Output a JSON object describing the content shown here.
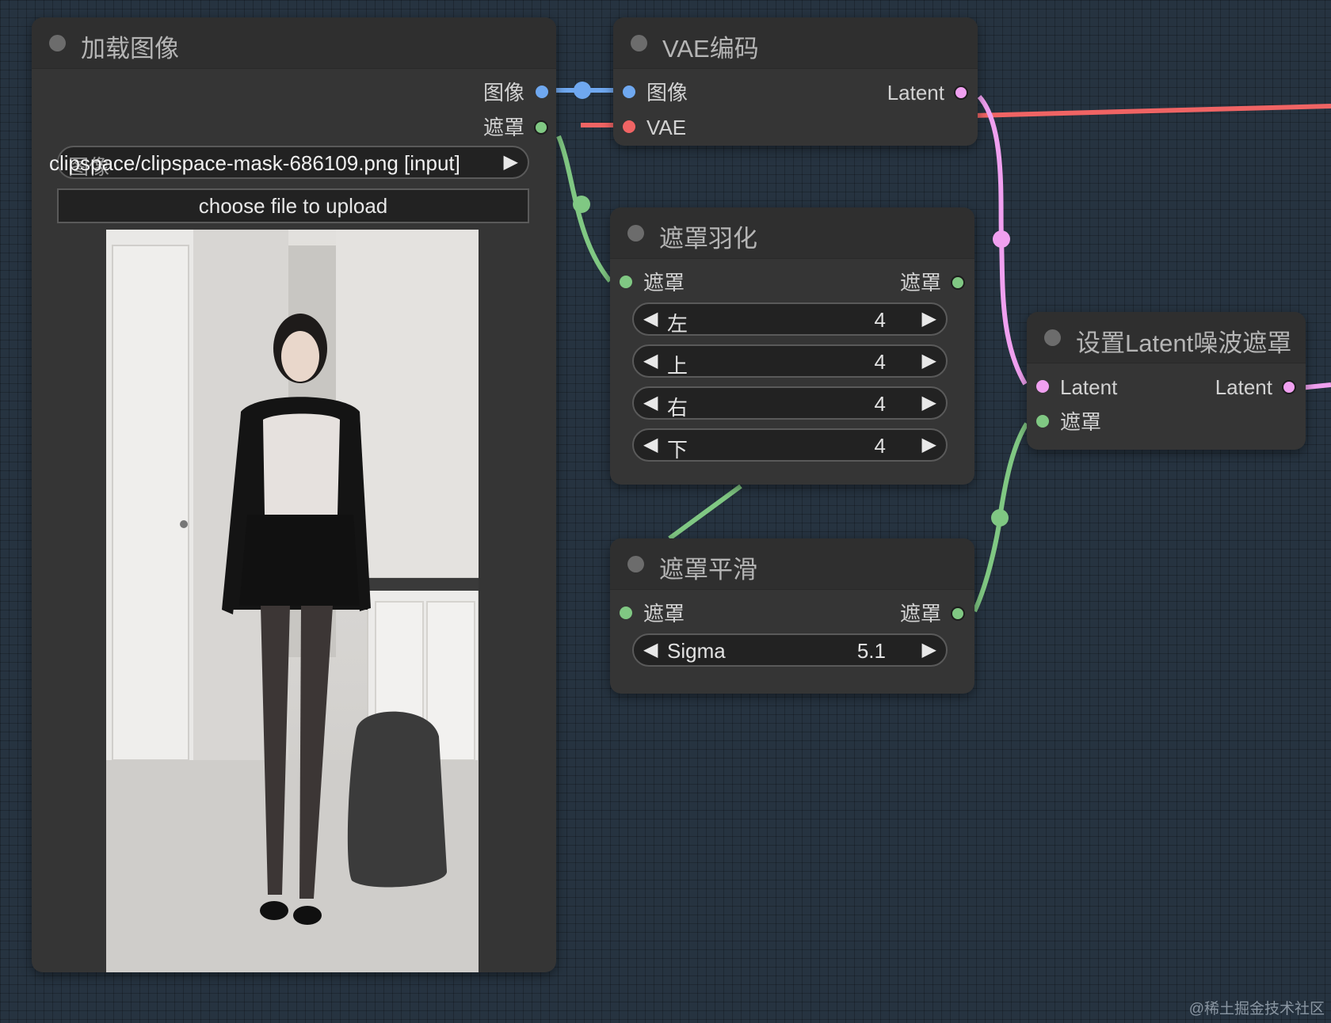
{
  "nodes": {
    "load_image": {
      "title": "加载图像",
      "outputs": [
        "图像",
        "遮罩"
      ],
      "image_widget": {
        "value": "clipspace/clipspace-mask-686109.png [input]",
        "label": "图像"
      },
      "upload_button": "choose file to upload"
    },
    "vae_encode": {
      "title": "VAE编码",
      "inputs": [
        "图像",
        "VAE"
      ],
      "outputs": [
        "Latent"
      ]
    },
    "mask_feather": {
      "title": "遮罩羽化",
      "inputs": [
        "遮罩"
      ],
      "outputs": [
        "遮罩"
      ],
      "widgets": [
        {
          "label": "左",
          "value": "4"
        },
        {
          "label": "上",
          "value": "4"
        },
        {
          "label": "右",
          "value": "4"
        },
        {
          "label": "下",
          "value": "4"
        }
      ]
    },
    "mask_smooth": {
      "title": "遮罩平滑",
      "inputs": [
        "遮罩"
      ],
      "outputs": [
        "遮罩"
      ],
      "widgets": [
        {
          "label": "Sigma",
          "value": "5.1"
        }
      ]
    },
    "set_latent_noise_mask": {
      "title": "设置Latent噪波遮罩",
      "inputs": [
        "Latent",
        "遮罩"
      ],
      "outputs": [
        "Latent"
      ]
    }
  },
  "colors": {
    "canvas": "#263340",
    "node_body": "#353535",
    "image_link": "#6fa8f0",
    "mask_link": "#80c883",
    "vae_link": "#f06464",
    "latent_link": "#f0a0f0"
  },
  "icons": [
    "collapse-dot",
    "arrow-left-icon",
    "arrow-right-icon"
  ],
  "watermark": "@稀土掘金技术社区"
}
